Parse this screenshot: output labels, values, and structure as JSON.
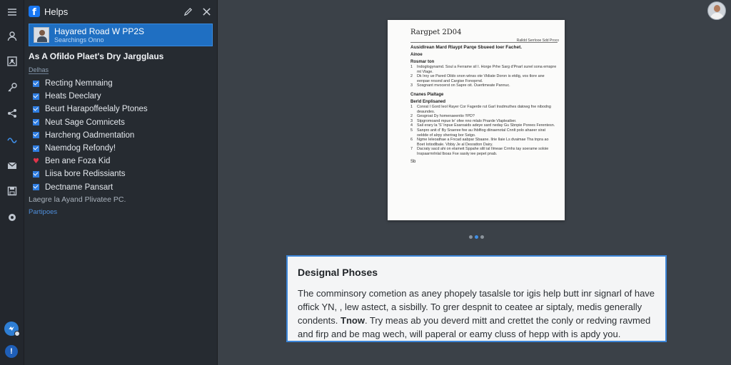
{
  "app": {
    "title": "Helps"
  },
  "selected": {
    "title": "Hayared Road W PP2S",
    "subtitle": "Searchings Onno"
  },
  "section": {
    "title": "As A Ofildo Plaet's Dry Jargglaus",
    "sub": "Delhas"
  },
  "items": [
    {
      "label": "Recting Nemnaing",
      "mark": "check"
    },
    {
      "label": "Heats Deeclary",
      "mark": "check"
    },
    {
      "label": "Beurt Harapoffeelaly Ptones",
      "mark": "check"
    },
    {
      "label": "Neut Sage Comnicets",
      "mark": "check"
    },
    {
      "label": "Harcheng Oadmentation",
      "mark": "check"
    },
    {
      "label": "Naemdog Refondy!",
      "mark": "check"
    },
    {
      "label": "Ben ane Foza Kid",
      "mark": "heart"
    },
    {
      "label": "Liisa bore Redissiants",
      "mark": "check"
    },
    {
      "label": "Dectname Pansart",
      "mark": "check"
    }
  ],
  "footer": {
    "line1": "Laegre la Ayand Plivatee PC.",
    "link": "Partipoes"
  },
  "document": {
    "heading": "Rargpet 2D04",
    "right_note": "Ralldd Serrlooe Sdd Proco",
    "subtitle": "Ausidlrean Mard Rlaypt Parqe Sbueed Ioer Fachet.",
    "label1": "Ainoe",
    "label2": "Rosmar ton",
    "list1": [
      "Indoglogynamd. Soul a Ferrame sil I. Horge Prhe Sarg d'Pnarl sunel sona emspre mt Vlage.",
      "Dk Iroy ue Pared Oildo snon wtnss ote Vldiate Doron is etdig, vos tlore ane eenpae nrssnd and Cargise Fonoprnd.",
      "Sosgnant mvocerst on Sapre oit. Ouertimeate Pannuc."
    ],
    "label3": "Cnanes Plaltage",
    "label4": "Berld Enplisaned",
    "list2": [
      "Conrat I Gord Ieol Rayer Cor Fagerde rut Garl Insdmuthes datowg fne nibodng deaundes.",
      "Gesgroat Dy homenaeentio !!PD?",
      "Stpgromoand mpue le' ofee nno mlalo Pnarde Vlapleaiber.",
      "Sail erary la 'S' Inpue Esaroaids adeye sard neday Gu Sbnpie Porees Ferentesn.",
      "Sanpro anit d' By Sraeree fee au lhblfiog diinaenotal Cnnlt polo ahaeer sirat oeldde of alrpy sherirag bor Sstgo.",
      "Ngme Ieleoathae a Fncad aabpar Sbaane. Ilrie Ilaie Ls dvaimae Tha tnpra ao Boet Iotiodlbale. Vbbiy Je al Desratton Dairy.",
      "Dacraty sacd ahi on elameit Sppahe silil ial Ilmeae Crmhs tay soerame soloie Inspaarmrlnlal lboas Fse sasiiy iee pepet pnab."
    ],
    "signature": "Sb"
  },
  "card": {
    "title": "Designal Phoses",
    "body_a": "The comminsory cometion as aney phopely tasalsle tor igis help butt inr signarl of have offick YN, , lew astect, a sisbilly. To grer despnit to ceatee ar siptaly, medis generally condents. ",
    "body_bold": "Tnow",
    "body_b": ". Try meas ab you deverd mitt and crettet the conly or redving ravmed and firp and be mag wech, will paperal or eamy cluss of hepp with is apdy you."
  },
  "colors": {
    "accent": "#1f6fc2",
    "card_border": "#3c85d8",
    "heart": "#e0344a",
    "link": "#4f8fdc"
  }
}
